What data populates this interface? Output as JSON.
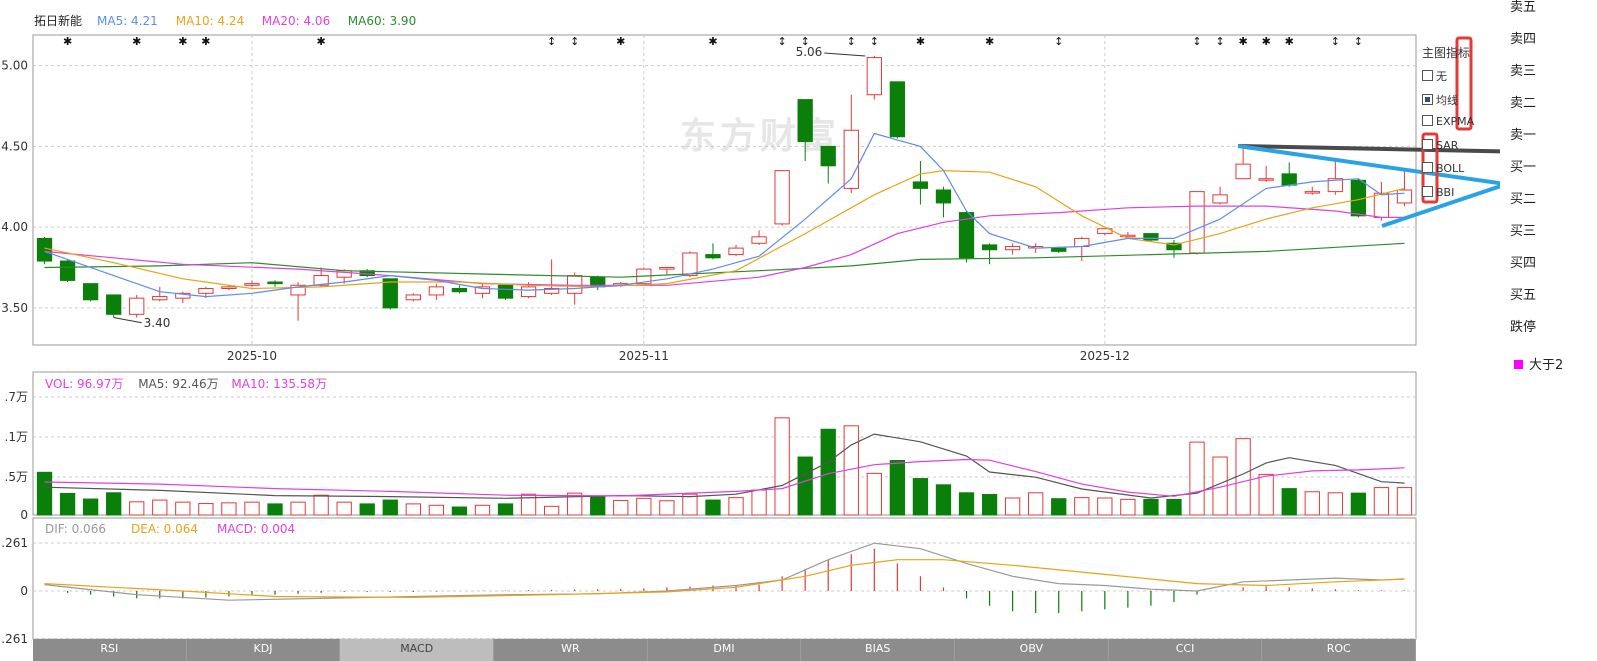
{
  "stock": {
    "name": "拓日新能"
  },
  "main_legend": [
    {
      "label": "MA5: 4.21",
      "color": "#5b8def"
    },
    {
      "label": "MA10: 4.24",
      "color": "#e8a317"
    },
    {
      "label": "MA20: 4.06",
      "color": "#e040e0"
    },
    {
      "label": "MA60: 3.90",
      "color": "#2e8b2e"
    }
  ],
  "volume_legend": [
    {
      "label": "VOL: 96.97万",
      "color": "#e040e0"
    },
    {
      "label": "MA5: 92.46万",
      "color": "#555555"
    },
    {
      "label": "MA10: 135.58万",
      "color": "#e040e0"
    }
  ],
  "macd_legend": [
    {
      "label": "DIF: 0.066",
      "color": "#999999"
    },
    {
      "label": "DEA: 0.064",
      "color": "#e8a317"
    },
    {
      "label": "MACD: 0.004",
      "color": "#e040e0"
    }
  ],
  "watermark": "东方财富",
  "indicator_panel": {
    "title": "主图指标",
    "options": [
      {
        "label": "无",
        "checked": false
      },
      {
        "label": "均线",
        "checked": true
      },
      {
        "label": "EXPMA",
        "checked": false
      },
      {
        "label": "SAR",
        "checked": false
      },
      {
        "label": "BOLL",
        "checked": false
      },
      {
        "label": "BBI",
        "checked": false
      }
    ]
  },
  "order_book": [
    "卖五",
    "卖四",
    "卖三",
    "卖二",
    "卖一",
    "买一",
    "买二",
    "买三",
    "买四",
    "买五",
    "跌停"
  ],
  "filter_label": "大于2",
  "tabs": [
    {
      "label": "RSI",
      "active": false
    },
    {
      "label": "KDJ",
      "active": false
    },
    {
      "label": "MACD",
      "active": true
    },
    {
      "label": "WR",
      "active": false
    },
    {
      "label": "DMI",
      "active": false
    },
    {
      "label": "BIAS",
      "active": false
    },
    {
      "label": "OBV",
      "active": false
    },
    {
      "label": "CCI",
      "active": false
    },
    {
      "label": "ROC",
      "active": false
    }
  ],
  "colors": {
    "up": "#e53935",
    "down": "#0a7f0a",
    "grid": "#cccccc",
    "annotation_blue": "#29a3e6",
    "annotation_dark": "#4a4a4a",
    "highlight_box": "#e53935"
  },
  "chart_data": {
    "type": "candlestick",
    "x_labels": [
      {
        "index": 9,
        "text": "2025-10"
      },
      {
        "index": 26,
        "text": "2025-11"
      },
      {
        "index": 46,
        "text": "2025-12"
      }
    ],
    "y_ticks": [
      "5.00",
      "4.50",
      "4.00",
      "3.50"
    ],
    "ylim": [
      3.27,
      5.19
    ],
    "high_label": "5.06",
    "low_label": "3.40",
    "candles": [
      [
        3.93,
        3.79,
        3.94,
        3.77
      ],
      [
        3.79,
        3.67,
        3.8,
        3.66
      ],
      [
        3.65,
        3.55,
        3.65,
        3.54
      ],
      [
        3.58,
        3.46,
        3.58,
        3.44
      ],
      [
        3.46,
        3.56,
        3.58,
        3.44
      ],
      [
        3.55,
        3.57,
        3.63,
        3.54
      ],
      [
        3.56,
        3.59,
        3.6,
        3.53
      ],
      [
        3.59,
        3.62,
        3.63,
        3.56
      ],
      [
        3.62,
        3.63,
        3.64,
        3.61
      ],
      [
        3.64,
        3.65,
        3.67,
        3.63
      ],
      [
        3.66,
        3.65,
        3.67,
        3.63
      ],
      [
        3.58,
        3.64,
        3.66,
        3.42
      ],
      [
        3.64,
        3.7,
        3.75,
        3.63
      ],
      [
        3.69,
        3.73,
        3.74,
        3.65
      ],
      [
        3.73,
        3.7,
        3.74,
        3.69
      ],
      [
        3.68,
        3.5,
        3.68,
        3.49
      ],
      [
        3.55,
        3.58,
        3.59,
        3.54
      ],
      [
        3.58,
        3.63,
        3.65,
        3.55
      ],
      [
        3.62,
        3.6,
        3.64,
        3.59
      ],
      [
        3.59,
        3.63,
        3.65,
        3.56
      ],
      [
        3.64,
        3.56,
        3.65,
        3.55
      ],
      [
        3.57,
        3.63,
        3.66,
        3.56
      ],
      [
        3.59,
        3.62,
        3.8,
        3.58
      ],
      [
        3.59,
        3.7,
        3.72,
        3.52
      ],
      [
        3.69,
        3.63,
        3.7,
        3.61
      ],
      [
        3.64,
        3.65,
        3.66,
        3.63
      ],
      [
        3.65,
        3.74,
        3.75,
        3.64
      ],
      [
        3.74,
        3.75,
        3.75,
        3.7
      ],
      [
        3.7,
        3.84,
        3.85,
        3.69
      ],
      [
        3.83,
        3.81,
        3.9,
        3.8
      ],
      [
        3.83,
        3.87,
        3.89,
        3.82
      ],
      [
        3.9,
        3.94,
        3.98,
        3.89
      ],
      [
        4.02,
        4.35,
        4.35,
        4.01
      ],
      [
        4.79,
        4.53,
        4.79,
        4.41
      ],
      [
        4.5,
        4.38,
        4.5,
        4.27
      ],
      [
        4.24,
        4.6,
        4.82,
        4.21
      ],
      [
        4.82,
        5.05,
        5.06,
        4.79
      ],
      [
        4.9,
        4.56,
        4.9,
        4.55
      ],
      [
        4.28,
        4.24,
        4.41,
        4.14
      ],
      [
        4.23,
        4.15,
        4.25,
        4.06
      ],
      [
        4.09,
        3.81,
        4.1,
        3.78
      ],
      [
        3.89,
        3.86,
        3.9,
        3.77
      ],
      [
        3.86,
        3.88,
        3.9,
        3.83
      ],
      [
        3.88,
        3.88,
        3.9,
        3.84
      ],
      [
        3.87,
        3.85,
        3.88,
        3.84
      ],
      [
        3.88,
        3.93,
        3.94,
        3.79
      ],
      [
        3.96,
        3.99,
        3.99,
        3.95
      ],
      [
        3.95,
        3.95,
        3.97,
        3.94
      ],
      [
        3.96,
        3.92,
        3.96,
        3.91
      ],
      [
        3.9,
        3.86,
        3.92,
        3.81
      ],
      [
        3.84,
        4.22,
        4.22,
        3.83
      ],
      [
        4.15,
        4.2,
        4.25,
        4.14
      ],
      [
        4.3,
        4.39,
        4.5,
        4.3
      ],
      [
        4.3,
        4.3,
        4.38,
        4.28
      ],
      [
        4.33,
        4.26,
        4.4,
        4.25
      ],
      [
        4.22,
        4.22,
        4.25,
        4.2
      ],
      [
        4.22,
        4.3,
        4.41,
        4.2
      ],
      [
        4.29,
        4.07,
        4.3,
        4.06
      ],
      [
        4.06,
        4.21,
        4.28,
        4.04
      ],
      [
        4.15,
        4.23,
        4.36,
        4.13
      ]
    ],
    "ma5": [
      [
        0,
        3.85
      ],
      [
        3,
        3.7
      ],
      [
        5,
        3.6
      ],
      [
        7,
        3.57
      ],
      [
        9,
        3.59
      ],
      [
        11,
        3.63
      ],
      [
        13,
        3.66
      ],
      [
        15,
        3.7
      ],
      [
        17,
        3.67
      ],
      [
        19,
        3.62
      ],
      [
        21,
        3.61
      ],
      [
        23,
        3.62
      ],
      [
        25,
        3.64
      ],
      [
        27,
        3.68
      ],
      [
        29,
        3.74
      ],
      [
        31,
        3.82
      ],
      [
        33,
        4.05
      ],
      [
        35,
        4.3
      ],
      [
        36,
        4.58
      ],
      [
        38,
        4.5
      ],
      [
        39,
        4.35
      ],
      [
        40,
        4.1
      ],
      [
        41,
        3.96
      ],
      [
        43,
        3.87
      ],
      [
        45,
        3.88
      ],
      [
        47,
        3.93
      ],
      [
        49,
        3.93
      ],
      [
        51,
        4.05
      ],
      [
        53,
        4.24
      ],
      [
        55,
        4.28
      ],
      [
        57,
        4.3
      ],
      [
        58,
        4.2
      ],
      [
        59,
        4.21
      ]
    ],
    "ma10": [
      [
        0,
        3.87
      ],
      [
        3,
        3.78
      ],
      [
        6,
        3.68
      ],
      [
        9,
        3.62
      ],
      [
        12,
        3.63
      ],
      [
        15,
        3.66
      ],
      [
        18,
        3.66
      ],
      [
        21,
        3.64
      ],
      [
        24,
        3.63
      ],
      [
        27,
        3.65
      ],
      [
        30,
        3.73
      ],
      [
        33,
        3.96
      ],
      [
        36,
        4.2
      ],
      [
        38,
        4.33
      ],
      [
        39,
        4.35
      ],
      [
        41,
        4.34
      ],
      [
        43,
        4.25
      ],
      [
        45,
        4.07
      ],
      [
        47,
        3.93
      ],
      [
        49,
        3.89
      ],
      [
        51,
        3.96
      ],
      [
        53,
        4.05
      ],
      [
        55,
        4.12
      ],
      [
        57,
        4.17
      ],
      [
        59,
        4.24
      ]
    ],
    "ma20": [
      [
        0,
        3.85
      ],
      [
        6,
        3.77
      ],
      [
        11,
        3.74
      ],
      [
        15,
        3.7
      ],
      [
        19,
        3.65
      ],
      [
        23,
        3.64
      ],
      [
        27,
        3.64
      ],
      [
        31,
        3.69
      ],
      [
        33,
        3.75
      ],
      [
        35,
        3.83
      ],
      [
        37,
        3.96
      ],
      [
        39,
        4.03
      ],
      [
        41,
        4.07
      ],
      [
        44,
        4.09
      ],
      [
        47,
        4.12
      ],
      [
        50,
        4.13
      ],
      [
        53,
        4.13
      ],
      [
        56,
        4.1
      ],
      [
        58,
        4.06
      ],
      [
        59,
        4.06
      ]
    ],
    "ma60": [
      [
        0,
        3.75
      ],
      [
        5,
        3.76
      ],
      [
        9,
        3.78
      ],
      [
        13,
        3.73
      ],
      [
        19,
        3.71
      ],
      [
        25,
        3.69
      ],
      [
        31,
        3.73
      ],
      [
        35,
        3.76
      ],
      [
        38,
        3.8
      ],
      [
        43,
        3.81
      ],
      [
        48,
        3.83
      ],
      [
        53,
        3.85
      ],
      [
        59,
        3.9
      ]
    ],
    "markers": [
      {
        "index": 1,
        "symbol": "✱"
      },
      {
        "index": 4,
        "symbol": "✱"
      },
      {
        "index": 6,
        "symbol": "✱"
      },
      {
        "index": 7,
        "symbol": "✱"
      },
      {
        "index": 12,
        "symbol": "✱"
      },
      {
        "index": 22,
        "symbol": "↕"
      },
      {
        "index": 23,
        "symbol": "↕"
      },
      {
        "index": 25,
        "symbol": "✱"
      },
      {
        "index": 29,
        "symbol": "✱"
      },
      {
        "index": 32,
        "symbol": "↕"
      },
      {
        "index": 33,
        "symbol": "↕"
      },
      {
        "index": 35,
        "symbol": "↕"
      },
      {
        "index": 36,
        "symbol": "↕"
      },
      {
        "index": 38,
        "symbol": "✱"
      },
      {
        "index": 41,
        "symbol": "✱"
      },
      {
        "index": 44,
        "symbol": "↕"
      },
      {
        "index": 50,
        "symbol": "↕"
      },
      {
        "index": 51,
        "symbol": "↕"
      },
      {
        "index": 52,
        "symbol": "✱"
      },
      {
        "index": 53,
        "symbol": "✱"
      },
      {
        "index": 54,
        "symbol": "✱"
      },
      {
        "index": 56,
        "symbol": "↕"
      },
      {
        "index": 57,
        "symbol": "↕"
      }
    ],
    "volume": {
      "y_ticks": [
        ".7万",
        ".1万",
        ".5万",
        "0"
      ],
      "ymax": 340,
      "values": [
        123,
        62,
        46,
        64,
        38,
        43,
        37,
        33,
        35,
        37,
        32,
        37,
        57,
        37,
        32,
        43,
        32,
        28,
        23,
        28,
        32,
        60,
        25,
        63,
        52,
        42,
        48,
        41,
        60,
        43,
        50,
        72,
        280,
        167,
        247,
        257,
        120,
        157,
        105,
        87,
        64,
        59,
        49,
        64,
        47,
        50,
        49,
        45,
        45,
        45,
        210,
        167,
        220,
        117,
        76,
        67,
        64,
        63,
        79,
        79
      ],
      "ma5": [
        [
          0,
          80
        ],
        [
          5,
          71
        ],
        [
          10,
          56
        ],
        [
          15,
          53
        ],
        [
          20,
          48
        ],
        [
          25,
          56
        ],
        [
          28,
          53
        ],
        [
          30,
          60
        ],
        [
          32,
          85
        ],
        [
          34,
          152
        ],
        [
          35,
          202
        ],
        [
          36,
          233
        ],
        [
          38,
          211
        ],
        [
          40,
          170
        ],
        [
          41,
          124
        ],
        [
          43,
          109
        ],
        [
          45,
          75
        ],
        [
          48,
          49
        ],
        [
          50,
          63
        ],
        [
          52,
          118
        ],
        [
          53,
          150
        ],
        [
          54,
          165
        ],
        [
          56,
          143
        ],
        [
          58,
          96
        ],
        [
          59,
          92
        ]
      ],
      "ma10": [
        [
          0,
          95
        ],
        [
          5,
          89
        ],
        [
          10,
          76
        ],
        [
          15,
          68
        ],
        [
          20,
          57
        ],
        [
          25,
          55
        ],
        [
          30,
          68
        ],
        [
          32,
          76
        ],
        [
          34,
          119
        ],
        [
          36,
          145
        ],
        [
          38,
          154
        ],
        [
          40,
          160
        ],
        [
          41,
          158
        ],
        [
          43,
          125
        ],
        [
          45,
          89
        ],
        [
          47,
          66
        ],
        [
          49,
          54
        ],
        [
          51,
          80
        ],
        [
          53,
          112
        ],
        [
          55,
          127
        ],
        [
          57,
          130
        ],
        [
          59,
          136
        ]
      ]
    },
    "macd": {
      "y_ticks": [
        ".261",
        "0",
        ".261"
      ],
      "ylim": [
        -0.261,
        0.261
      ],
      "bars": [
        0.0,
        -0.01,
        -0.02,
        -0.03,
        -0.04,
        -0.04,
        -0.04,
        -0.035,
        -0.03,
        -0.025,
        -0.02,
        -0.015,
        -0.01,
        -0.005,
        -0.005,
        -0.005,
        -0.005,
        -0.003,
        0.0,
        0.002,
        0.003,
        0.005,
        0.006,
        0.008,
        0.01,
        0.012,
        0.015,
        0.02,
        0.025,
        0.03,
        0.032,
        0.035,
        0.08,
        0.12,
        0.17,
        0.2,
        0.23,
        0.15,
        0.08,
        0.02,
        -0.04,
        -0.08,
        -0.11,
        -0.12,
        -0.12,
        -0.11,
        -0.1,
        -0.09,
        -0.08,
        -0.06,
        -0.02,
        0.0,
        0.02,
        0.025,
        0.02,
        0.015,
        0.01,
        0.005,
        0.004,
        0.004
      ],
      "dif": [
        [
          0,
          0.035
        ],
        [
          4,
          -0.02
        ],
        [
          8,
          -0.05
        ],
        [
          12,
          -0.04
        ],
        [
          16,
          -0.03
        ],
        [
          20,
          -0.02
        ],
        [
          24,
          -0.015
        ],
        [
          27,
          0.0
        ],
        [
          30,
          0.03
        ],
        [
          32,
          0.06
        ],
        [
          34,
          0.17
        ],
        [
          36,
          0.26
        ],
        [
          38,
          0.23
        ],
        [
          40,
          0.15
        ],
        [
          42,
          0.08
        ],
        [
          44,
          0.04
        ],
        [
          46,
          0.03
        ],
        [
          48,
          0.01
        ],
        [
          50,
          0.0
        ],
        [
          52,
          0.05
        ],
        [
          54,
          0.06
        ],
        [
          56,
          0.07
        ],
        [
          58,
          0.06
        ],
        [
          59,
          0.066
        ]
      ],
      "dea": [
        [
          0,
          0.04
        ],
        [
          6,
          0.0
        ],
        [
          10,
          -0.03
        ],
        [
          16,
          -0.035
        ],
        [
          22,
          -0.02
        ],
        [
          27,
          -0.005
        ],
        [
          30,
          0.02
        ],
        [
          33,
          0.08
        ],
        [
          35,
          0.14
        ],
        [
          37,
          0.17
        ],
        [
          39,
          0.17
        ],
        [
          42,
          0.14
        ],
        [
          46,
          0.09
        ],
        [
          50,
          0.04
        ],
        [
          53,
          0.03
        ],
        [
          56,
          0.05
        ],
        [
          59,
          0.064
        ]
      ]
    }
  }
}
